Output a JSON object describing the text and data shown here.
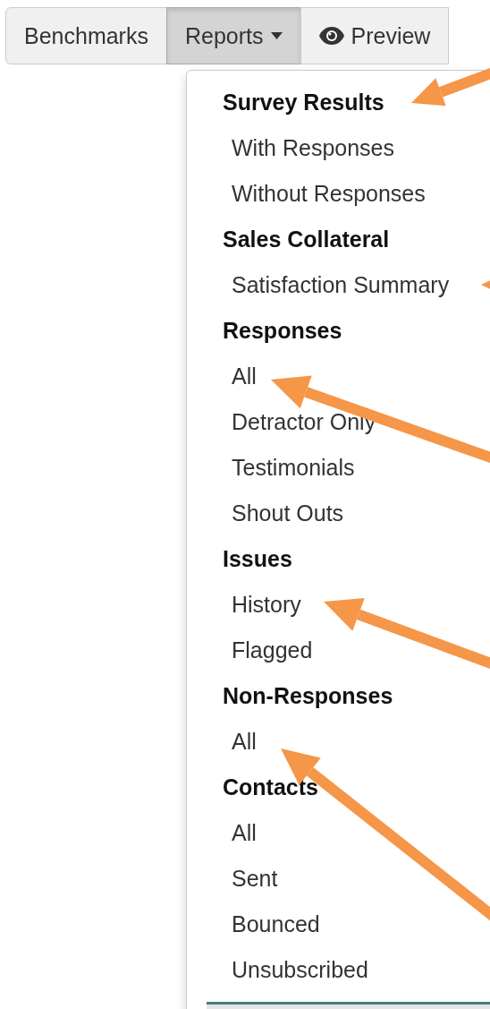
{
  "toolbar": {
    "buttons": [
      {
        "label": "Benchmarks",
        "selected": false,
        "kind": "plain"
      },
      {
        "label": "Reports",
        "selected": true,
        "kind": "dropdown"
      },
      {
        "label": "Preview",
        "selected": false,
        "kind": "eye"
      }
    ]
  },
  "menu": {
    "sections": [
      {
        "header": "Survey Results",
        "items": [
          "With Responses",
          "Without Responses"
        ]
      },
      {
        "header": "Sales Collateral",
        "items": [
          "Satisfaction Summary"
        ]
      },
      {
        "header": "Responses",
        "items": [
          "All",
          "Detractor Only",
          "Testimonials",
          "Shout Outs"
        ]
      },
      {
        "header": "Issues",
        "items": [
          "History",
          "Flagged"
        ]
      },
      {
        "header": "Non-Responses",
        "items": [
          "All"
        ]
      },
      {
        "header": "Contacts",
        "items": [
          "All",
          "Sent",
          "Bounced",
          "Unsubscribed"
        ]
      }
    ]
  }
}
